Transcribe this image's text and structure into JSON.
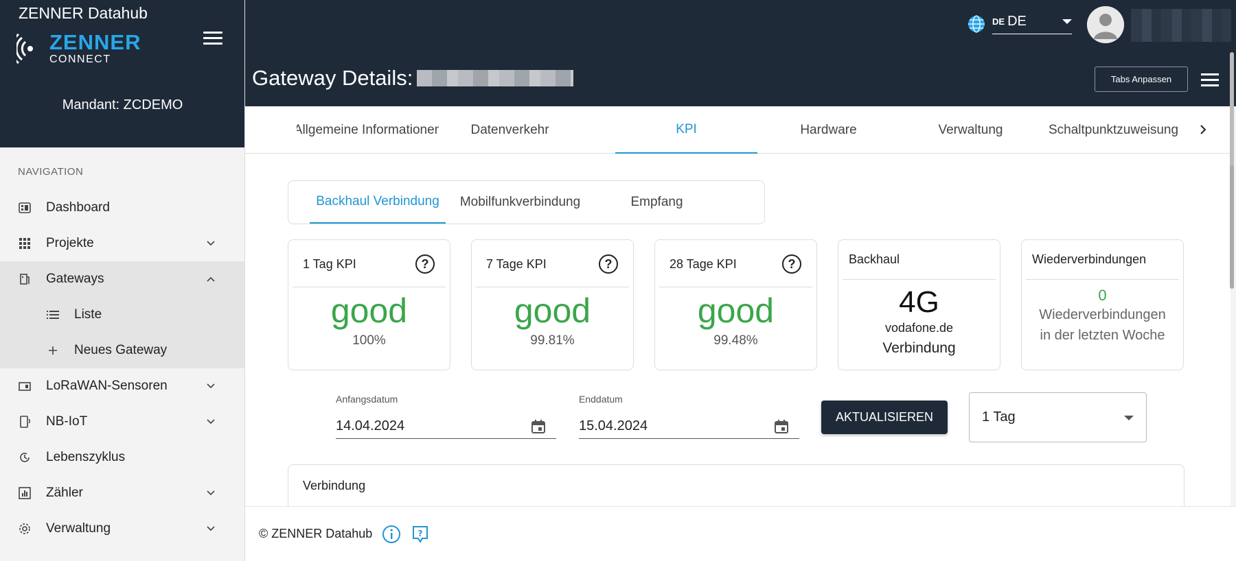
{
  "sidebar": {
    "app_title": "ZENNER Datahub",
    "logo_brand": "ZENNER",
    "logo_sub": "CONNECT",
    "mandant": "Mandant: ZCDEMO",
    "nav_caption": "NAVIGATION",
    "items": [
      {
        "label": "Dashboard",
        "icon": "dashboard-icon"
      },
      {
        "label": "Projekte",
        "icon": "grid-icon"
      },
      {
        "label": "Gateways",
        "icon": "gateway-icon"
      },
      {
        "label": "Liste",
        "icon": "list-icon"
      },
      {
        "label": "Neues Gateway",
        "icon": "plus-icon"
      },
      {
        "label": "LoRaWAN-Sensoren",
        "icon": "sensor-icon"
      },
      {
        "label": "NB-IoT",
        "icon": "nbiot-icon"
      },
      {
        "label": "Lebenszyklus",
        "icon": "lifecycle-icon"
      },
      {
        "label": "Zähler",
        "icon": "meter-icon"
      },
      {
        "label": "Verwaltung",
        "icon": "gear-icon"
      }
    ]
  },
  "header": {
    "page_title": "Gateway Details:",
    "lang_small": "DE",
    "lang_label": "DE",
    "tabs_anpassen": "Tabs Anpassen"
  },
  "main_tabs": [
    {
      "label": "Allgemeine Informationen"
    },
    {
      "label": "Datenverkehr"
    },
    {
      "label": "KPI"
    },
    {
      "label": "Hardware"
    },
    {
      "label": "Verwaltung"
    },
    {
      "label": "Schaltpunktzuweisung"
    }
  ],
  "sub_tabs": [
    {
      "label": "Backhaul Verbindung"
    },
    {
      "label": "Mobilfunkverbindung"
    },
    {
      "label": "Empfang"
    }
  ],
  "kpi_cards": [
    {
      "title": "1 Tag KPI",
      "value": "good",
      "pct": "100%"
    },
    {
      "title": "7 Tage KPI",
      "value": "good",
      "pct": "99.81%"
    },
    {
      "title": "28 Tage KPI",
      "value": "good",
      "pct": "99.48%"
    }
  ],
  "backhaul_card": {
    "title": "Backhaul",
    "tech": "4G",
    "provider": "vodafone.de",
    "status": "Verbindung"
  },
  "reconnect_card": {
    "title": "Wiederverbindungen",
    "count": "0",
    "line1": "Wiederverbindungen",
    "line2": "in der letzten Woche"
  },
  "filters": {
    "start_label": "Anfangsdatum",
    "start_value": "14.04.2024",
    "end_label": "Enddatum",
    "end_value": "15.04.2024",
    "refresh_label": "AKTUALISIEREN",
    "range_value": "1 Tag"
  },
  "verbindung_title": "Verbindung",
  "footer": {
    "copyright": "© ZENNER Datahub"
  },
  "colors": {
    "navy": "#1e2a38",
    "accent": "#2196d3",
    "good": "#3aa64a",
    "brand_blue": "#2aa6e8"
  }
}
